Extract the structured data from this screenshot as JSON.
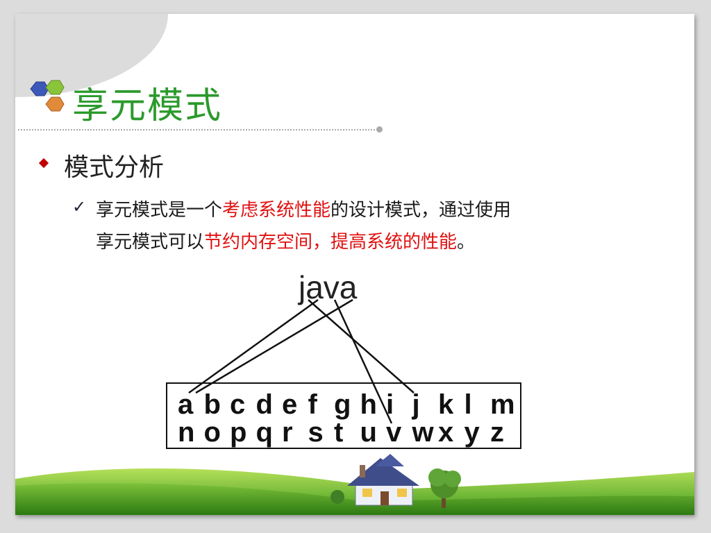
{
  "slide": {
    "title": "享元模式",
    "heading": "模式分析",
    "paragraph": {
      "line1": [
        {
          "text": "享元模式是一个",
          "red": false
        },
        {
          "text": "考虑系统性能",
          "red": true
        },
        {
          "text": "的设计模式，通过使用",
          "red": false
        }
      ],
      "line2": [
        {
          "text": "享元模式可以",
          "red": false
        },
        {
          "text": "节约内存空间，提高系统的性能",
          "red": true
        },
        {
          "text": "。",
          "red": false
        }
      ]
    }
  },
  "diagram": {
    "word": "java",
    "row1": [
      "a",
      "b",
      "c",
      "d",
      "e",
      "f",
      "g",
      "h",
      "i",
      "j",
      "k",
      "l",
      "m"
    ],
    "row2": [
      "n",
      "o",
      "p",
      "q",
      "r",
      "s",
      "t",
      "u",
      "v",
      "w",
      "x",
      "y",
      "z"
    ]
  },
  "colors": {
    "title": "#2b9a2b",
    "highlight": "#e01010",
    "hex_blue": "#3c58b8",
    "hex_green": "#8ac43a",
    "hex_orange": "#e08a3a"
  }
}
